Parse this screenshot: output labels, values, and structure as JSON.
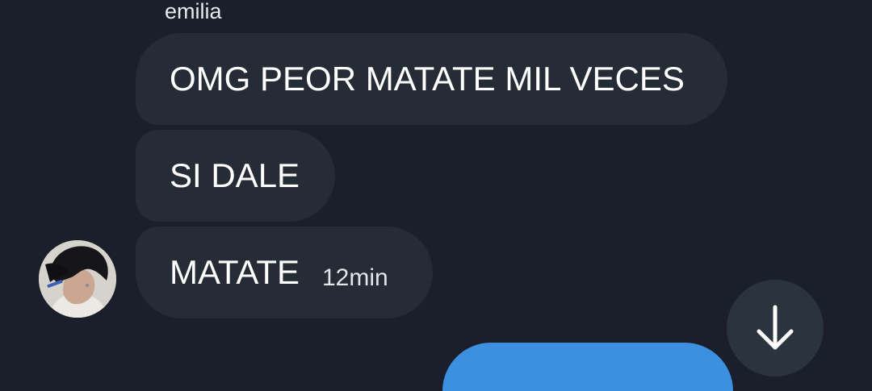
{
  "chat": {
    "sender_name": "emilia",
    "messages": [
      {
        "text": "OMG PEOR MATATE MIL VECES"
      },
      {
        "text": "SI DALE"
      },
      {
        "text": "MATATE",
        "time": "12min"
      }
    ]
  },
  "icons": {
    "scroll_down": "arrow-down-icon",
    "avatar": "profile-photo"
  },
  "colors": {
    "background": "#1a1f2b",
    "incoming_bubble": "#252c36",
    "outgoing_bubble": "#3d8fe0",
    "fab": "#2b333e"
  }
}
